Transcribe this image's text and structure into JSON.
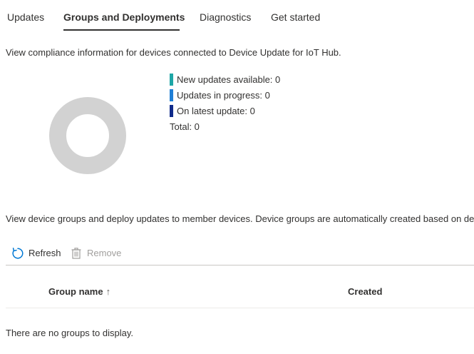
{
  "tabs": [
    {
      "label": "Updates",
      "active": false
    },
    {
      "label": "Groups and Deployments",
      "active": true
    },
    {
      "label": "Diagnostics",
      "active": false
    },
    {
      "label": "Get started",
      "active": false
    }
  ],
  "compliance": {
    "description": "View compliance information for devices connected to Device Update for IoT Hub.",
    "legend": [
      {
        "label": "New updates available: 0",
        "value": 0,
        "color": "#1ea6a6"
      },
      {
        "label": "Updates in progress: 0",
        "value": 0,
        "color": "#1f7fd6"
      },
      {
        "label": "On latest update: 0",
        "value": 0,
        "color": "#102a8a"
      }
    ],
    "total": "Total: 0",
    "donut_empty_color": "#d2d2d2"
  },
  "groups": {
    "description": "View device groups and deploy updates to member devices. Device groups are automatically created based on dev",
    "toolbar": {
      "refresh_label": "Refresh",
      "remove_label": "Remove"
    },
    "columns": {
      "group_name": "Group name",
      "sort_indicator": "↑",
      "created": "Created"
    },
    "empty_message": "There are no groups to display."
  }
}
